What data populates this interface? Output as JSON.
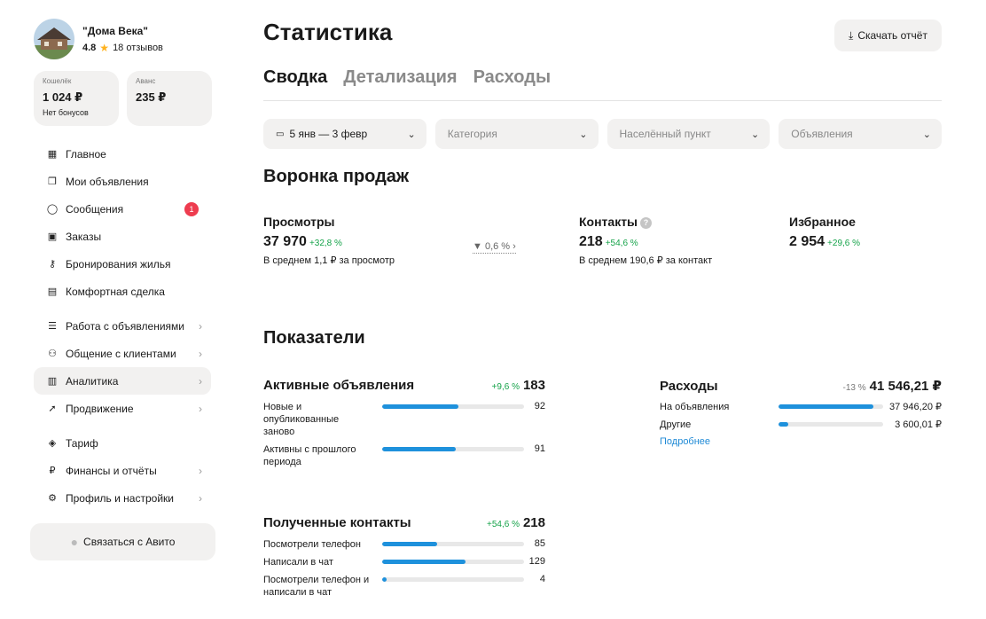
{
  "sidebar": {
    "profile": {
      "name": "\"Дома Века\"",
      "rating": "4.8",
      "reviews": "18 отзывов"
    },
    "wallet": {
      "label": "Кошелёк",
      "value": "1 024 ₽",
      "sub": "Нет бонусов"
    },
    "advance": {
      "label": "Аванс",
      "value": "235 ₽"
    },
    "items": [
      {
        "label": "Главное",
        "icon": "grid-icon"
      },
      {
        "label": "Мои объявления",
        "icon": "copy-icon"
      },
      {
        "label": "Сообщения",
        "icon": "chat-icon",
        "badge": "1"
      },
      {
        "label": "Заказы",
        "icon": "box-icon"
      },
      {
        "label": "Бронирования жилья",
        "icon": "key-icon"
      },
      {
        "label": "Комфортная сделка",
        "icon": "deal-icon"
      },
      {
        "label": "Работа с объявлениями",
        "icon": "list-icon"
      },
      {
        "label": "Общение с клиентами",
        "icon": "users-icon"
      },
      {
        "label": "Аналитика",
        "icon": "chart-icon"
      },
      {
        "label": "Продвижение",
        "icon": "rocket-icon"
      },
      {
        "label": "Тариф",
        "icon": "tariff-icon"
      },
      {
        "label": "Финансы и отчёты",
        "icon": "ruble-icon"
      },
      {
        "label": "Профиль и настройки",
        "icon": "settings-icon"
      }
    ],
    "contact_button": "Связаться с Авито"
  },
  "header": {
    "title": "Статистика",
    "download": "Скачать отчёт",
    "tabs": [
      "Сводка",
      "Детализация",
      "Расходы"
    ]
  },
  "filters": {
    "date": "5 янв — 3 февр",
    "category": "Категория",
    "city": "Населённый пункт",
    "ads": "Объявления"
  },
  "funnel": {
    "title": "Воронка продаж",
    "views": {
      "name": "Просмотры",
      "value": "37 970",
      "delta": "+32,8 %",
      "sub": "В среднем 1,1 ₽ за просмотр"
    },
    "conversion": "0,6 %",
    "contacts": {
      "name": "Контакты",
      "value": "218",
      "delta": "+54,6 %",
      "sub": "В среднем 190,6 ₽ за контакт"
    },
    "favorites": {
      "name": "Избранное",
      "value": "2 954",
      "delta": "+29,6 %"
    }
  },
  "kpi": {
    "title": "Показатели",
    "active_ads": {
      "name": "Активные объявления",
      "delta": "+9,6 %",
      "total": "183",
      "rows": [
        {
          "label": "Новые и опубликованные заново",
          "value": "92",
          "share": 0.54
        },
        {
          "label": "Активны с прошлого периода",
          "value": "91",
          "share": 0.52
        }
      ]
    },
    "expenses": {
      "name": "Расходы",
      "delta": "-13 %",
      "total": "41 546,21 ₽",
      "rows": [
        {
          "label": "На объявления",
          "value": "37 946,20 ₽",
          "share": 0.91
        },
        {
          "label": "Другие",
          "value": "3 600,01 ₽",
          "share": 0.09
        }
      ],
      "more": "Подробнее"
    },
    "contacts": {
      "name": "Полученные контакты",
      "delta": "+54,6 %",
      "total": "218",
      "rows": [
        {
          "label": "Посмотрели телефон",
          "value": "85",
          "share": 0.39
        },
        {
          "label": "Написали в чат",
          "value": "129",
          "share": 0.59
        },
        {
          "label": "Посмотрели телефон и написали в чат",
          "value": "4",
          "share": 0.03
        }
      ]
    }
  }
}
